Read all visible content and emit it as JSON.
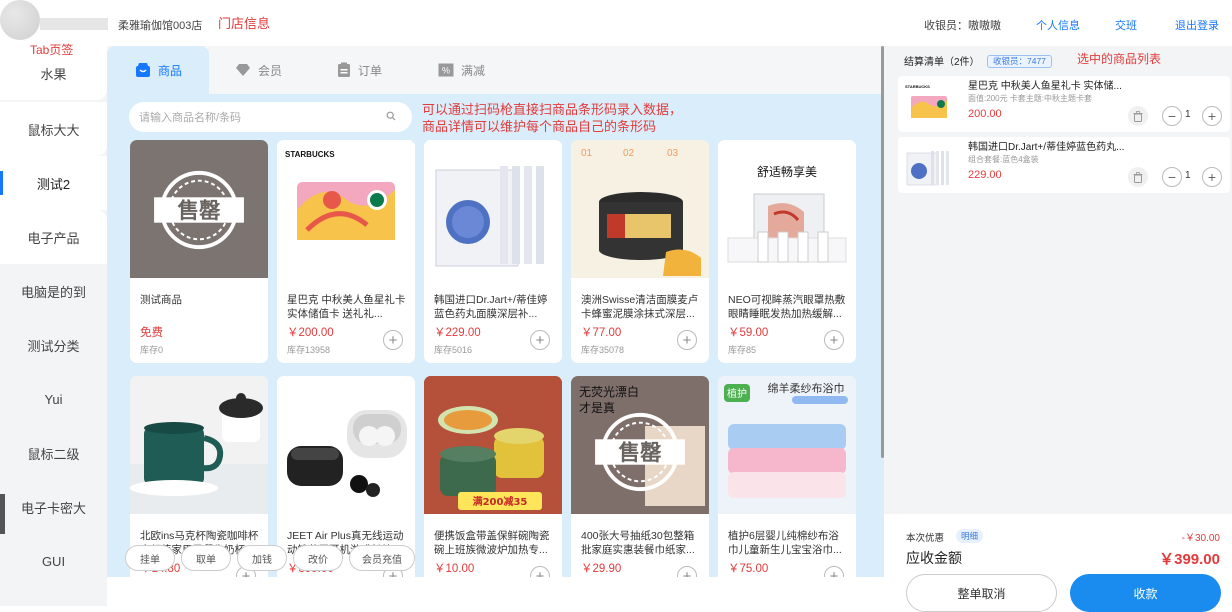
{
  "header": {
    "store_name_suffix": "柔雅瑜伽馆003店",
    "cashier_label": "收银员：嗷嗷嗷",
    "links": [
      "个人信息",
      "交班",
      "退出登录"
    ]
  },
  "annotations": {
    "store_info": "门店信息",
    "tab_label": "Tab页签",
    "selected_list": "选中的商品列表",
    "barcode_note": [
      "可以通过扫码枪直接扫商品条形码录入数据，",
      "商品详情可以维护每个商品自己的条形码"
    ]
  },
  "sidebar": {
    "categories": [
      "水果",
      "鼠标大大",
      "测试2",
      "电子产品",
      "电脑是的到",
      "测试分类",
      "Yui",
      "鼠标二级",
      "电子卡密大",
      "GUI"
    ],
    "active_index": 2
  },
  "tabs": [
    {
      "label": "商品",
      "icon": "shop-icon",
      "active": true
    },
    {
      "label": "会员",
      "icon": "diamond-icon",
      "active": false
    },
    {
      "label": "订单",
      "icon": "clipboard-icon",
      "active": false
    },
    {
      "label": "满减",
      "icon": "percent-icon",
      "active": false
    }
  ],
  "search": {
    "placeholder": "请输入商品名称/条码"
  },
  "products": [
    {
      "name": "测试商品",
      "price": "免费",
      "stock": "库存0"
    },
    {
      "name": "星巴克 中秋美人鱼星礼卡 实体储值卡 送礼礼...",
      "price": "￥200.00",
      "stock": "库存13958"
    },
    {
      "name": "韩国进口Dr.Jart+/蒂佳婷蓝色药丸面膜深层补...",
      "price": "￥229.00",
      "stock": "库存5016"
    },
    {
      "name": "澳洲Swisse清洁面膜麦卢卡蜂蜜泥膜涂抹式深层...",
      "price": "￥77.00",
      "stock": "库存35078"
    },
    {
      "name": "NEO可视眸蒸汽眼罩热敷眼睛睡眠发热加热缓解...",
      "price": "￥59.00",
      "stock": "库存85"
    },
    {
      "name": "北欧ins马克杯陶瓷咖啡杯高颜值家用早餐牛奶杯...",
      "price": "￥14.80",
      "stock": ""
    },
    {
      "name": "JEET Air Plus真无线运动动铁蓝牙耳机游戏长续...",
      "price": "￥399.00",
      "stock": ""
    },
    {
      "name": "便携饭盒带盖保鲜碗陶瓷碗上班族微波炉加热专...",
      "price": "￥10.00",
      "stock": ""
    },
    {
      "name": "400张大号抽纸30包整箱批家庭实惠装餐巾纸家...",
      "price": "￥29.90",
      "stock": ""
    },
    {
      "name": "植护6层婴儿纯棉纱布浴巾儿童新生儿宝宝浴巾...",
      "price": "￥75.00",
      "stock": ""
    }
  ],
  "product_image_text": {
    "sold_out": "售罄",
    "starbucks": "STARBUCKS",
    "neo_slogan": "舒适畅享美",
    "towel_brand": "植护",
    "towel_slogan": "绵羊柔纱布浴巾",
    "tissue_slogan": [
      "无荧光漂白",
      "才是真"
    ],
    "bento_promo": "满200减35"
  },
  "bottom_buttons": [
    "挂单",
    "取单",
    "加钱",
    "改价",
    "会员充值"
  ],
  "cart": {
    "title": "结算清单（2件）",
    "cashier_tag": "收银员：7477",
    "items": [
      {
        "name": "星巴克 中秋美人鱼星礼卡 实体储...",
        "sub": "面值:200元 卡套主题:中秋主题卡套",
        "price": "200.00",
        "qty": "1"
      },
      {
        "name": "韩国进口Dr.Jart+/蒂佳婷蓝色药丸...",
        "sub": "组合套餐:蓝色4盒装",
        "price": "229.00",
        "qty": "1"
      }
    ]
  },
  "summary": {
    "discount_label": "本次优惠",
    "detail_tag": "明细",
    "discount_value": "-￥30.00",
    "due_label": "应收金额",
    "due_value": "￥399.00",
    "cancel_label": "整单取消",
    "pay_label": "收款"
  },
  "colors": {
    "accent": "#1677ff",
    "price_red": "#e23b3b",
    "annotation_red": "#e23b3b",
    "main_bg": "#d9eefa"
  }
}
